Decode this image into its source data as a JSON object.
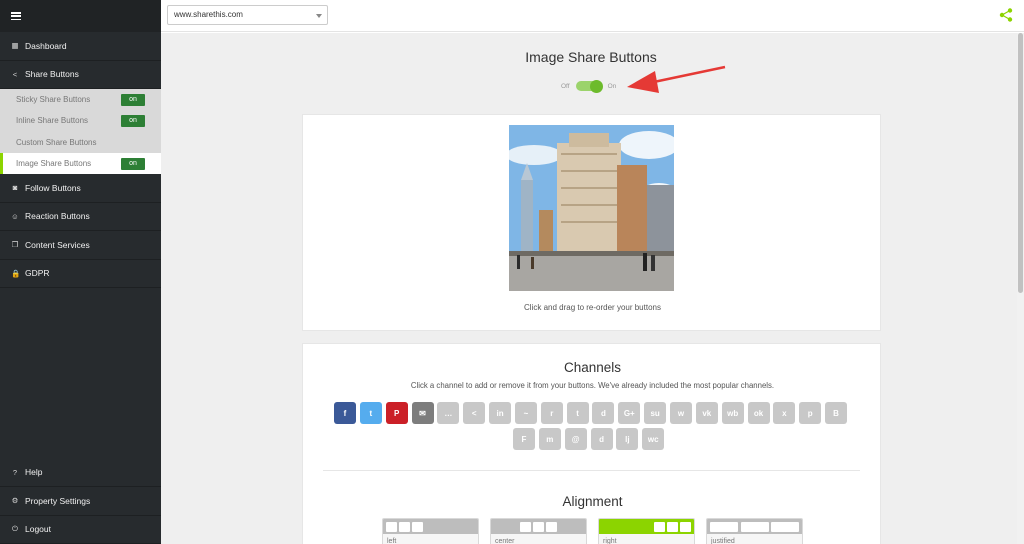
{
  "sidebar": {
    "nav": [
      {
        "label": "Dashboard",
        "icon": "grid-icon"
      },
      {
        "label": "Share Buttons",
        "icon": "share-icon"
      }
    ],
    "sub_items": [
      {
        "label": "Sticky Share Buttons",
        "badge": "on"
      },
      {
        "label": "Inline Share Buttons",
        "badge": "on"
      },
      {
        "label": "Custom Share Buttons",
        "badge": ""
      },
      {
        "label": "Image Share Buttons",
        "badge": "on"
      }
    ],
    "nav2": [
      {
        "label": "Follow Buttons",
        "icon": "rss-icon"
      },
      {
        "label": "Reaction Buttons",
        "icon": "smiley-icon"
      },
      {
        "label": "Content Services",
        "icon": "copy-icon"
      },
      {
        "label": "GDPR",
        "icon": "lock-icon"
      }
    ],
    "bottom": [
      {
        "label": "Help",
        "icon": "question-icon"
      },
      {
        "label": "Property Settings",
        "icon": "gear-icon"
      },
      {
        "label": "Logout",
        "icon": "power-icon"
      }
    ]
  },
  "topbar": {
    "site": "www.sharethis.com",
    "share_icon": "share-icon",
    "accent": "#8cd400"
  },
  "main": {
    "title": "Image Share Buttons",
    "toggle_off": "Off",
    "toggle_on": "On",
    "drag_text": "Click and drag to re-order your buttons",
    "channels_title": "Channels",
    "channels_sub": "Click a channel to add or remove it from your buttons. We've already included the most popular channels.",
    "channels_row1": [
      {
        "name": "facebook",
        "glyph": "f",
        "color": "#3b5998"
      },
      {
        "name": "twitter",
        "glyph": "t",
        "color": "#55acee"
      },
      {
        "name": "pinterest",
        "glyph": "P",
        "color": "#cb2027"
      },
      {
        "name": "email",
        "glyph": "✉",
        "color": "#7d7d7d"
      },
      {
        "name": "sms",
        "glyph": "…",
        "color": "#c8c8c8"
      },
      {
        "name": "sharethis",
        "glyph": "<",
        "color": "#c8c8c8"
      },
      {
        "name": "linkedin",
        "glyph": "in",
        "color": "#c8c8c8"
      },
      {
        "name": "messenger",
        "glyph": "~",
        "color": "#c8c8c8"
      },
      {
        "name": "reddit",
        "glyph": "r",
        "color": "#c8c8c8"
      },
      {
        "name": "tumblr",
        "glyph": "t",
        "color": "#c8c8c8"
      },
      {
        "name": "digg",
        "glyph": "d",
        "color": "#c8c8c8"
      },
      {
        "name": "googleplus",
        "glyph": "G+",
        "color": "#c8c8c8"
      },
      {
        "name": "stumbleupon",
        "glyph": "su",
        "color": "#c8c8c8"
      },
      {
        "name": "whatsapp",
        "glyph": "w",
        "color": "#c8c8c8"
      },
      {
        "name": "vk",
        "glyph": "vk",
        "color": "#c8c8c8"
      },
      {
        "name": "weibo",
        "glyph": "wb",
        "color": "#c8c8c8"
      },
      {
        "name": "odnoklassniki",
        "glyph": "ok",
        "color": "#c8c8c8"
      },
      {
        "name": "xing",
        "glyph": "x",
        "color": "#c8c8c8"
      },
      {
        "name": "print",
        "glyph": "p",
        "color": "#c8c8c8"
      },
      {
        "name": "blogger",
        "glyph": "B",
        "color": "#c8c8c8"
      }
    ],
    "channels_row2": [
      {
        "name": "flipboard",
        "glyph": "F",
        "color": "#c8c8c8"
      },
      {
        "name": "meneame",
        "glyph": "m",
        "color": "#c8c8c8"
      },
      {
        "name": "mailru",
        "glyph": "@",
        "color": "#c8c8c8"
      },
      {
        "name": "delicious",
        "glyph": "d",
        "color": "#c8c8c8"
      },
      {
        "name": "livejournal",
        "glyph": "lj",
        "color": "#c8c8c8"
      },
      {
        "name": "wechat",
        "glyph": "wc",
        "color": "#c8c8c8"
      }
    ],
    "alignment_title": "Alignment",
    "alignment": [
      {
        "label": "left",
        "active": false
      },
      {
        "label": "center",
        "active": false
      },
      {
        "label": "right",
        "active": true
      },
      {
        "label": "justified",
        "active": false
      }
    ],
    "annotation_arrow_color": "#e53935"
  }
}
